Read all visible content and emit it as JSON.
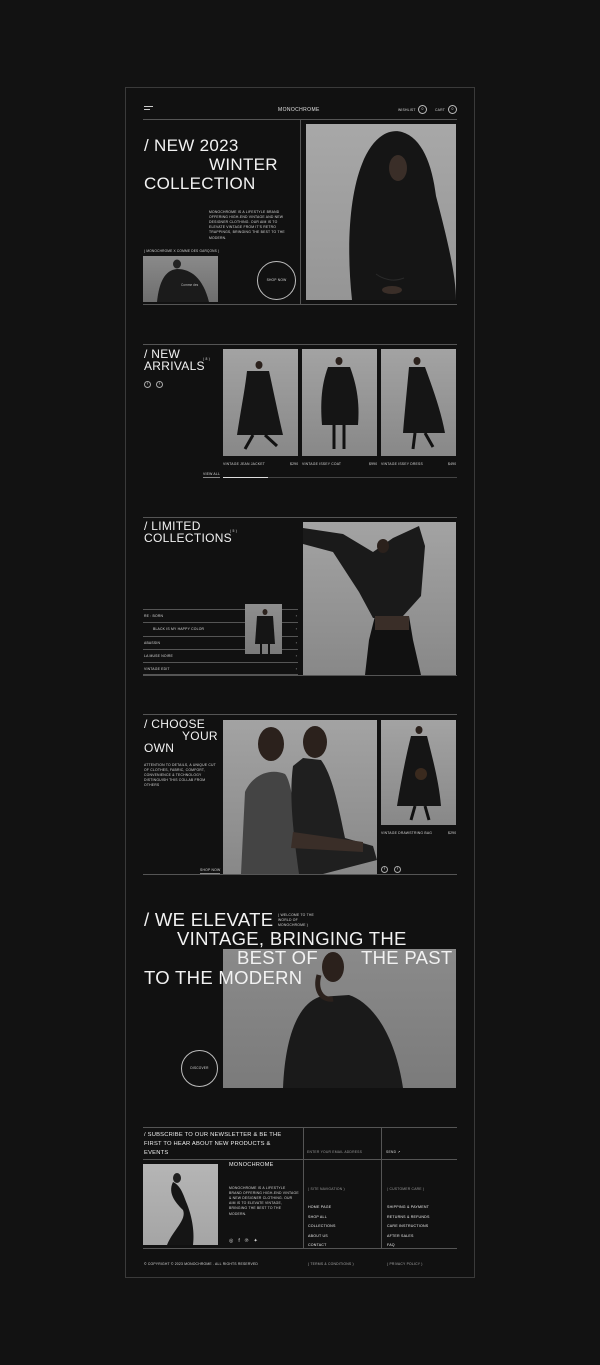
{
  "header": {
    "brand": "MONOCHROME",
    "wishlist_label": "WISHLIST",
    "wishlist_count": "0",
    "cart_label": "CART",
    "cart_count": "0"
  },
  "hero": {
    "title_line1": "/ NEW 2023",
    "title_line2": "WINTER",
    "title_line3": "COLLECTION",
    "description": "MONOCHROME IS A LIFESTYLE BRAND OFFERING HIGH-END VINTAGE AND NEW DESIGNER CLOTHING. OUR AIM IS TO ELEVATE VINTAGE FROM IT'S RETRO TRAPPINGS, BRINGING THE BEST TO THE MODERN.",
    "thumb_caption": "( MONOCHROME X COMME DES GARÇONS )",
    "shop_now": "SHOP NOW"
  },
  "new_arrivals": {
    "title_line1": "/ NEW",
    "title_line2": "ARRIVALS",
    "count": "( 8 )",
    "view_all": "VIEW ALL",
    "products": [
      {
        "name": "VINTAGE JEAN JACKET",
        "price": "$290"
      },
      {
        "name": "VINTAGE ISSEY COAT",
        "price": "$990"
      },
      {
        "name": "VINTAGE ISSEY DRESS",
        "price": "$490"
      }
    ]
  },
  "limited": {
    "title_line1": "/ LIMITED",
    "title_line2": "COLLECTIONS",
    "count": "( 5 )",
    "items": [
      "RE : BORN",
      "BLACK IS MY HAPPY COLOR",
      "ABASSIN",
      "LA MUSE NOIRE",
      "VINTAGE EDIT"
    ]
  },
  "choose": {
    "title_line1": "/ CHOOSE",
    "title_line2": "YOUR",
    "title_line3": "OWN",
    "description": "ATTENTION TO DETAILS, A UNIQUE CUT OF CLOTHES, FABRIC, COMFORT, CONVENIENCE & TECHNOLOGY DISTINGUISH THIS COLLAB FROM OTHERS",
    "shop_now": "SHOP NOW",
    "product_name": "VINTAGE DRAWSTRING BAG",
    "product_price": "$290"
  },
  "elevate": {
    "line1": "/ WE ELEVATE",
    "line2": "VINTAGE, BRINGING THE",
    "line3a": "BEST OF",
    "line3b": "THE PAST",
    "line4": "TO THE MODERN",
    "note": "( WELCOME TO THE WORLD OF MONOCHROME )",
    "discover": "DISCOVER"
  },
  "newsletter": {
    "heading": "/ SUBSCRIBE TO OUR NEWSLETTER & BE THE FIRST TO HEAR ABOUT NEW PRODUCTS & EVENTS",
    "placeholder": "ENTER YOUR EMAIL ADDRESS",
    "send": "SEND"
  },
  "footer": {
    "brand": "MONOCHROME",
    "about": "MONOCHROME IS A LIFESTYLE BRAND OFFERING HIGH-END VINTAGE & NEW DESIGNER CLOTHING. OUR AIM IS TO ELEVATE VINTAGE, BRINGING THE BEST TO THE MODERN.",
    "nav_heading": "( SITE NAVIGATION )",
    "nav": [
      "HOME PAGE",
      "SHOP ALL",
      "COLLECTIONS",
      "ABOUT US",
      "CONTACT"
    ],
    "care_heading": "( CUSTOMER CARE )",
    "care": [
      "SHIPPING & PAYMENT",
      "RETURNS & REFUNDS",
      "CARE INSTRUCTIONS",
      "AFTER SALES",
      "FAQ"
    ],
    "copyright": "© COPYRIGHT © 2023 MONOCHROME . ALL RIGHTS RESERVED",
    "terms": "( TERMS & CONDITIONS )",
    "privacy": "( PRIVACY POLICY )",
    "social": [
      "instagram-icon",
      "facebook-icon",
      "pinterest-icon",
      "twitter-icon"
    ]
  }
}
